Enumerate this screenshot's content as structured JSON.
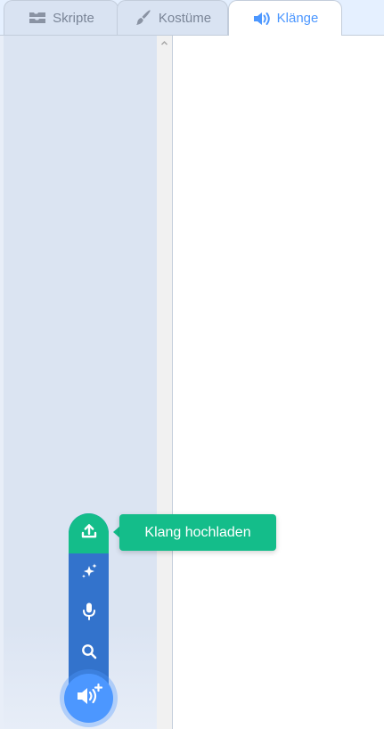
{
  "tabs": [
    {
      "label": "Skripte",
      "icon": "code-blocks-icon",
      "active": false
    },
    {
      "label": "Kostüme",
      "icon": "paintbrush-icon",
      "active": false
    },
    {
      "label": "Klänge",
      "icon": "speaker-icon",
      "active": true
    }
  ],
  "sound_menu": {
    "tooltip": "Klang hochladen",
    "items": [
      {
        "icon": "upload-icon"
      },
      {
        "icon": "sparkle-icon"
      },
      {
        "icon": "microphone-icon"
      },
      {
        "icon": "search-icon"
      }
    ],
    "main_icon": "add-sound-icon"
  },
  "colors": {
    "accent": "#4c97ff",
    "menu_blue": "#3373cc",
    "upload_green": "#14bd8a",
    "tab_inactive_text": "#7a8597",
    "list_background": "#dbe4f2"
  }
}
